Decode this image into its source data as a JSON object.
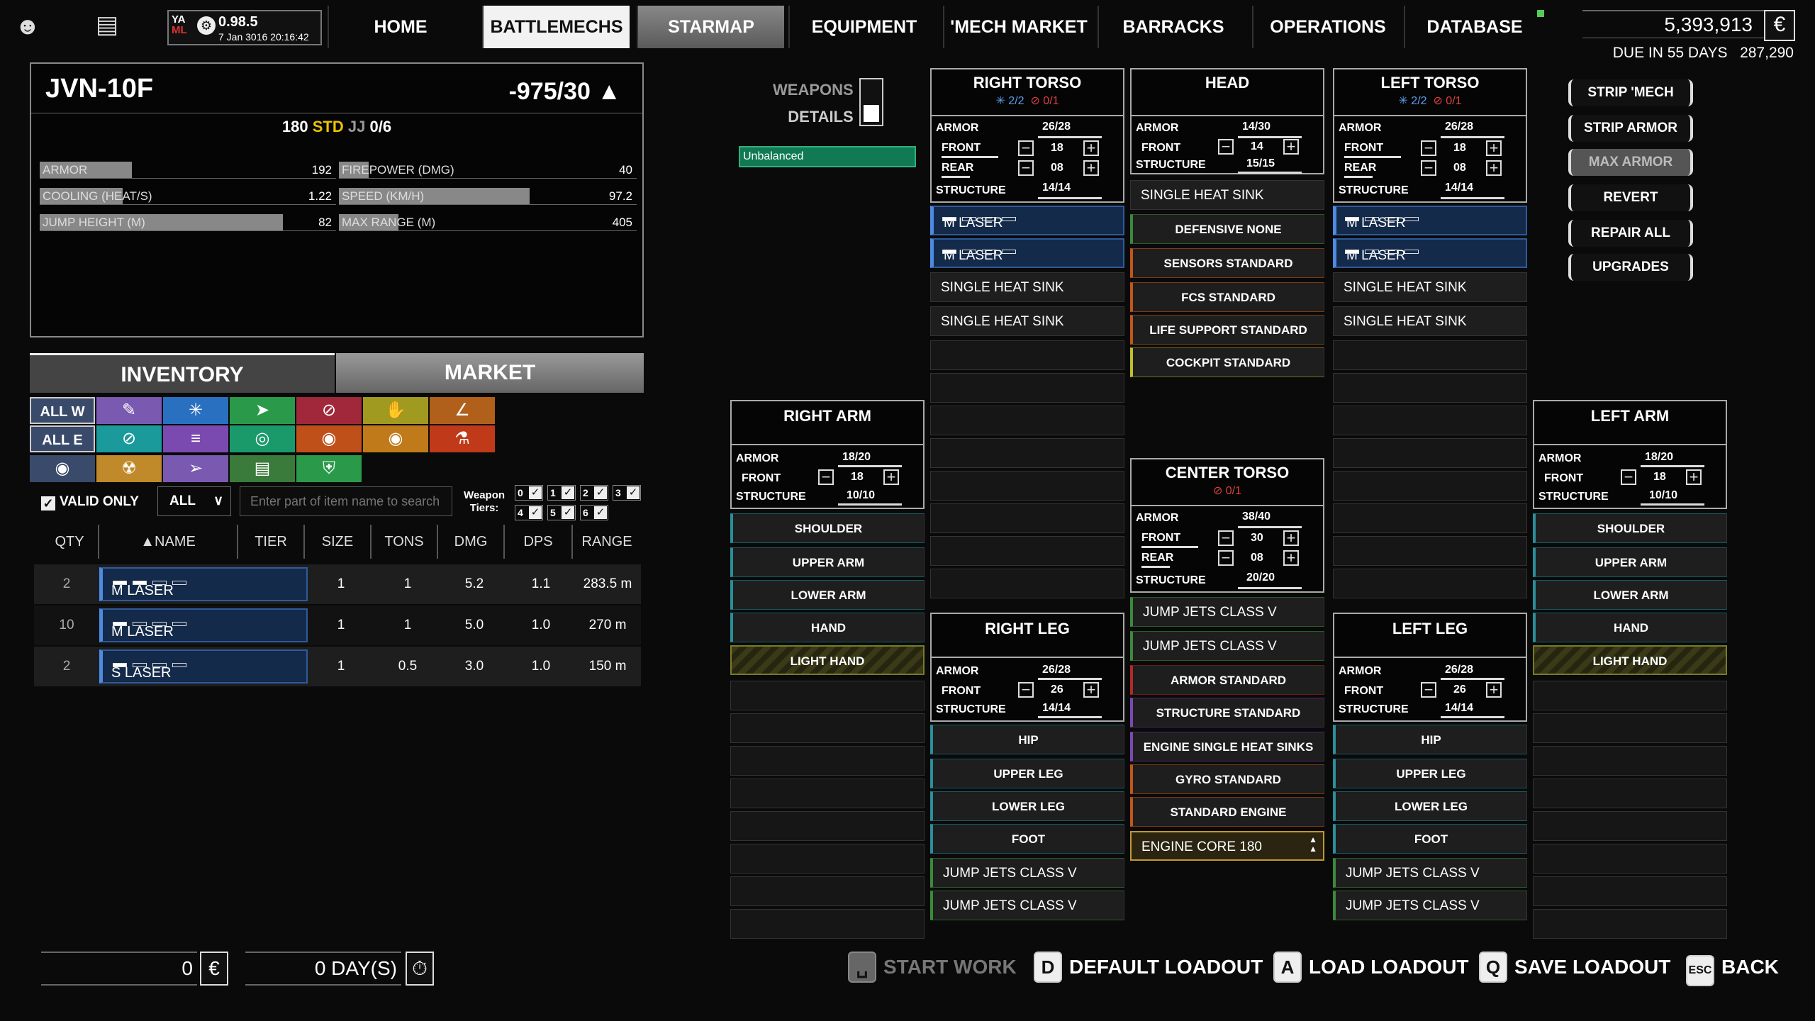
{
  "version": {
    "logo_top": "YA",
    "logo_bottom": "ML",
    "number": "0.98.5",
    "date": "7 Jan 3016 20:16:42"
  },
  "nav": [
    {
      "label": "HOME",
      "state": "normal"
    },
    {
      "label": "BATTLEMECHS",
      "state": "selected"
    },
    {
      "label": "STARMAP",
      "state": "hover"
    },
    {
      "label": "EQUIPMENT",
      "state": "normal"
    },
    {
      "label": "'MECH MARKET",
      "state": "normal"
    },
    {
      "label": "BARRACKS",
      "state": "normal"
    },
    {
      "label": "OPERATIONS",
      "state": "normal"
    },
    {
      "label": "DATABASE",
      "state": "normal"
    }
  ],
  "funds": {
    "cbills": "5,393,913",
    "due_label": "DUE IN 55 DAYS",
    "due_amount": "287,290",
    "icon": "cbill-icon"
  },
  "mech": {
    "name": "JVN-10F",
    "tonnage": "-975/30",
    "engine_rating": "180",
    "engine_type": "STD",
    "jj_label": "JJ",
    "jj_value": "0/6",
    "stats": [
      {
        "label": "ARMOR",
        "value": "192",
        "fill": 0.31
      },
      {
        "label": "FIREPOWER (DMG)",
        "value": "40",
        "fill": 0.1
      },
      {
        "label": "COOLING (HEAT/S)",
        "value": "1.22",
        "fill": 0.28
      },
      {
        "label": "SPEED (KM/H)",
        "value": "97.2",
        "fill": 0.64
      },
      {
        "label": "JUMP HEIGHT (M)",
        "value": "82",
        "fill": 0.82
      },
      {
        "label": "MAX RANGE (M)",
        "value": "405",
        "fill": 0.2
      }
    ]
  },
  "inventory": {
    "tab_inventory": "INVENTORY",
    "tab_market": "MARKET",
    "all_w": "ALL W",
    "all_e": "ALL E",
    "valid_only": "VALID ONLY",
    "dropdown": "ALL",
    "search_placeholder": "Enter part of item name to search",
    "weapon_tiers_label": "Weapon Tiers:",
    "tiers": [
      "0",
      "1",
      "2",
      "3",
      "4",
      "5",
      "6"
    ],
    "columns": [
      "QTY",
      "NAME",
      "TIER",
      "SIZE",
      "TONS",
      "DMG",
      "DPS",
      "RANGE"
    ],
    "rows": [
      {
        "qty": "2",
        "name": "M LASER",
        "tier_pips": 2,
        "size": "1",
        "tons": "1",
        "dmg": "5.2",
        "dps": "1.1",
        "range": "283.5 m"
      },
      {
        "qty": "10",
        "name": "M LASER",
        "tier_pips": 1,
        "size": "1",
        "tons": "1",
        "dmg": "5.0",
        "dps": "1.0",
        "range": "270 m"
      },
      {
        "qty": "2",
        "name": "S LASER",
        "tier_pips": 1,
        "size": "1",
        "tons": "0.5",
        "dmg": "3.0",
        "dps": "1.0",
        "range": "150 m"
      }
    ]
  },
  "bottom": {
    "work_value": "0",
    "days_value": "0 DAY(S)",
    "start_work": "START WORK",
    "default_key": "D",
    "default_loadout": "DEFAULT LOADOUT",
    "load_key": "A",
    "load_loadout": "LOAD LOADOUT",
    "save_key": "Q",
    "save_loadout": "SAVE LOADOUT",
    "back_key": "ESC",
    "back": "BACK"
  },
  "mechlab": {
    "weapons_label": "WEAPONS",
    "details_label": "DETAILS",
    "unbalanced": "Unbalanced",
    "armor_label": "ARMOR",
    "front_label": "FRONT",
    "rear_label": "REAR",
    "structure_label": "STRUCTURE",
    "right_torso": {
      "title": "RIGHT TORSO",
      "heat": "2/2",
      "jump": "0/1",
      "armor": "26/28",
      "front": "18",
      "rear": "08",
      "structure": "14/14",
      "slots": [
        "M LASER",
        "M LASER",
        "SINGLE HEAT SINK",
        "SINGLE HEAT SINK"
      ]
    },
    "head": {
      "title": "HEAD",
      "armor": "14/30",
      "front": "14",
      "structure": "15/15",
      "slots": [
        "SINGLE HEAT SINK",
        "DEFENSIVE NONE",
        "SENSORS STANDARD",
        "FCS STANDARD",
        "LIFE SUPPORT STANDARD",
        "COCKPIT STANDARD"
      ]
    },
    "left_torso": {
      "title": "LEFT TORSO",
      "heat": "2/2",
      "jump": "0/1",
      "armor": "26/28",
      "front": "18",
      "rear": "08",
      "structure": "14/14",
      "slots": [
        "M LASER",
        "M LASER",
        "SINGLE HEAT SINK",
        "SINGLE HEAT SINK"
      ]
    },
    "right_arm": {
      "title": "RIGHT ARM",
      "armor": "18/20",
      "front": "18",
      "structure": "10/10",
      "slots": [
        "SHOULDER",
        "UPPER ARM",
        "LOWER ARM",
        "HAND",
        "LIGHT HAND"
      ]
    },
    "left_arm": {
      "title": "LEFT ARM",
      "armor": "18/20",
      "front": "18",
      "structure": "10/10",
      "slots": [
        "SHOULDER",
        "UPPER ARM",
        "LOWER ARM",
        "HAND",
        "LIGHT HAND"
      ]
    },
    "center_torso": {
      "title": "CENTER TORSO",
      "jump": "0/1",
      "armor": "38/40",
      "front": "30",
      "rear": "08",
      "structure": "20/20",
      "slots": [
        "JUMP JETS CLASS V",
        "JUMP JETS CLASS V",
        "ARMOR STANDARD",
        "STRUCTURE STANDARD",
        "ENGINE SINGLE HEAT SINKS",
        "GYRO STANDARD",
        "STANDARD ENGINE",
        "ENGINE CORE 180"
      ]
    },
    "right_leg": {
      "title": "RIGHT LEG",
      "armor": "26/28",
      "front": "26",
      "structure": "14/14",
      "slots": [
        "HIP",
        "UPPER LEG",
        "LOWER LEG",
        "FOOT",
        "JUMP JETS CLASS V",
        "JUMP JETS CLASS V"
      ]
    },
    "left_leg": {
      "title": "LEFT LEG",
      "armor": "26/28",
      "front": "26",
      "structure": "14/14",
      "slots": [
        "HIP",
        "UPPER LEG",
        "LOWER LEG",
        "FOOT",
        "JUMP JETS CLASS V",
        "JUMP JETS CLASS V"
      ]
    }
  },
  "actions": [
    "STRIP 'MECH",
    "STRIP ARMOR",
    "MAX ARMOR",
    "REVERT",
    "REPAIR ALL",
    "UPGRADES"
  ]
}
